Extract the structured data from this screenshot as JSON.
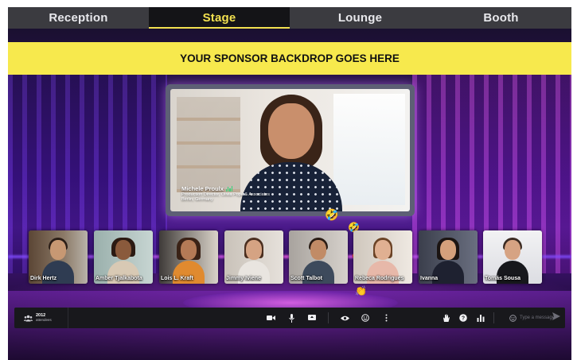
{
  "nav": {
    "tabs": [
      {
        "label": "Reception"
      },
      {
        "label": "Stage"
      },
      {
        "label": "Lounge"
      },
      {
        "label": "Booth"
      }
    ],
    "active_index": 1
  },
  "sponsor": {
    "text": "YOUR SPONSOR BACKDROP GOES HERE"
  },
  "speaker": {
    "name": "Michele Proulx",
    "title": "Production Director, Olivia Pope & Associates",
    "location": "Berlin, Germany"
  },
  "attendee_tiles": [
    {
      "name": "Dirk Hertz"
    },
    {
      "name": "Amber Tjalkabota"
    },
    {
      "name": "Lois L. Kraft"
    },
    {
      "name": "Jimmy Iviene"
    },
    {
      "name": "Scott Talbot"
    },
    {
      "name": "Rebeca Rodrigues"
    },
    {
      "name": "Ivanna"
    },
    {
      "name": "Tomás Sousa"
    }
  ],
  "reactions": [
    "🤣",
    "🤣",
    "❤️",
    "👍",
    "👏"
  ],
  "bottom_bar": {
    "attendee_count": "2012",
    "attendee_label": "attendees",
    "message_placeholder": "Type a message"
  },
  "icons": [
    "people-icon",
    "camera-icon",
    "mic-icon",
    "screen-share-icon",
    "eye-icon",
    "emoji-icon",
    "more-icon",
    "raise-hand-icon",
    "question-icon",
    "poll-icon",
    "smiley-icon",
    "send-icon"
  ],
  "colors": {
    "accent": "#f3e14f",
    "banner": "#f7e94d",
    "bar": "#18181c"
  }
}
